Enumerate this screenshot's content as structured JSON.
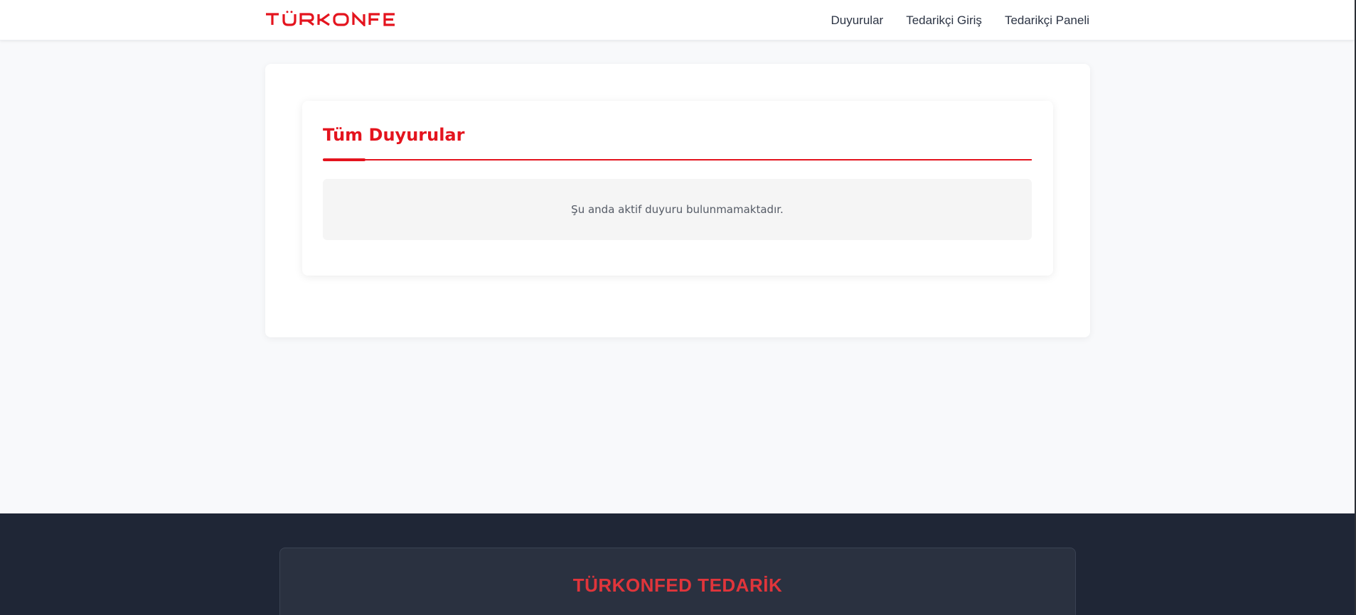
{
  "header": {
    "logo_text": "TÜRKONFED",
    "nav": [
      {
        "label": "Duyurular"
      },
      {
        "label": "Tedarikçi Giriş"
      },
      {
        "label": "Tedarikçi Paneli"
      }
    ]
  },
  "main": {
    "title": "Tüm Duyurular",
    "empty_message": "Şu anda aktif duyuru bulunmamaktadır."
  },
  "footer": {
    "title": "TÜRKONFED TEDARİK"
  },
  "colors": {
    "brand_red": "#e4141e",
    "footer_bg": "#1f2636",
    "page_bg": "#f8f9fb"
  }
}
